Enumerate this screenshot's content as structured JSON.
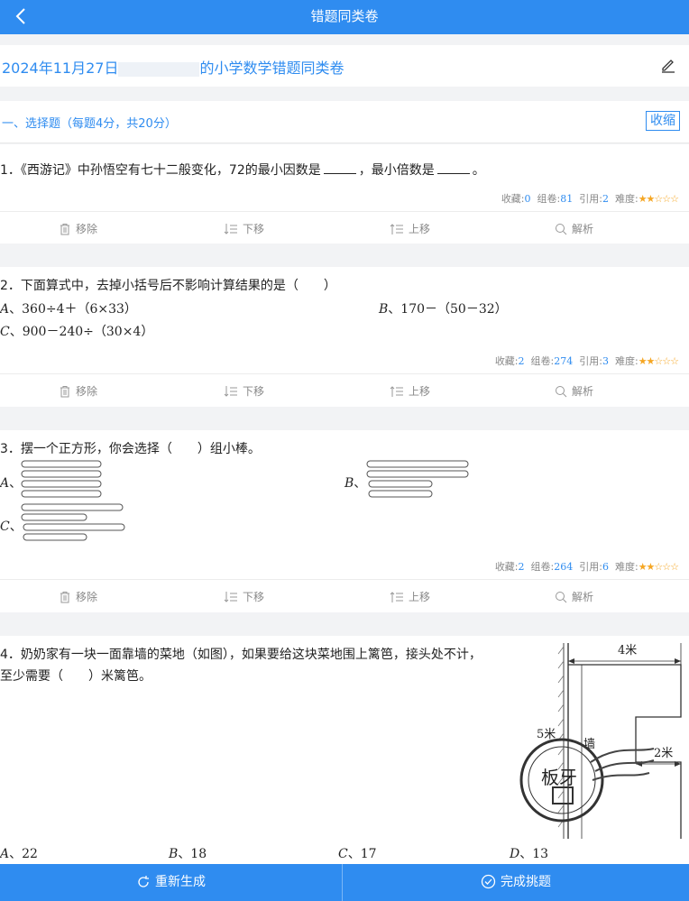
{
  "header": {
    "title": "错题同类卷"
  },
  "paper": {
    "title_left": "2024年11月27日",
    "title_right": "的小学数学错题同类卷"
  },
  "section": {
    "title": "一、选择题（每题4分，共20分）",
    "collapse_label": "收缩"
  },
  "labels": {
    "collect": "收藏:",
    "compose": "组卷:",
    "cite": "引用:",
    "difficulty": "难度:"
  },
  "actions": {
    "remove": "移除",
    "down": "下移",
    "up": "上移",
    "analysis": "解析"
  },
  "questions": [
    {
      "text_a": "1．《西游记》中孙悟空有七十二般变化，72的最小因数是",
      "text_b": "，最小倍数是",
      "text_c": "。",
      "collect": "0",
      "compose": "81",
      "cite": "2",
      "stars": "★★☆☆☆"
    },
    {
      "text": "2．下面算式中，去掉小括号后不影响计算结果的是（　　）",
      "options": [
        {
          "letter": "A",
          "text": "、360÷4＋（6×33）"
        },
        {
          "letter": "B",
          "text": "、170－（50－32）"
        },
        {
          "letter": "C",
          "text": "、900－240÷（30×4）"
        }
      ],
      "collect": "2",
      "compose": "274",
      "cite": "3",
      "stars": "★★☆☆☆"
    },
    {
      "text": "3．摆一个正方形，你会选择（　　）组小棒。",
      "options": [
        {
          "letter": "A",
          "text": "、"
        },
        {
          "letter": "B",
          "text": "、"
        },
        {
          "letter": "C",
          "text": "、"
        }
      ],
      "collect": "2",
      "compose": "264",
      "cite": "6",
      "stars": "★★☆☆☆"
    },
    {
      "text_line1": "4．奶奶家有一块一面靠墙的菜地（如图），如果要给这块菜地围上篱笆，接头处不计，",
      "text_line2": "至少需要（　　）米篱笆。",
      "figure": {
        "top_label": "4米",
        "left_label": "5米",
        "right_label": "2米",
        "wall_label": "墙",
        "stamp_text": "板牙"
      },
      "options": [
        {
          "letter": "A",
          "text": "、22"
        },
        {
          "letter": "B",
          "text": "、18"
        },
        {
          "letter": "C",
          "text": "、17"
        },
        {
          "letter": "D",
          "text": "、13"
        }
      ]
    }
  ],
  "footer": {
    "regenerate": "重新生成",
    "finish": "完成挑题"
  },
  "colors": {
    "primary": "#2f8cf0",
    "star": "#f5a623"
  }
}
